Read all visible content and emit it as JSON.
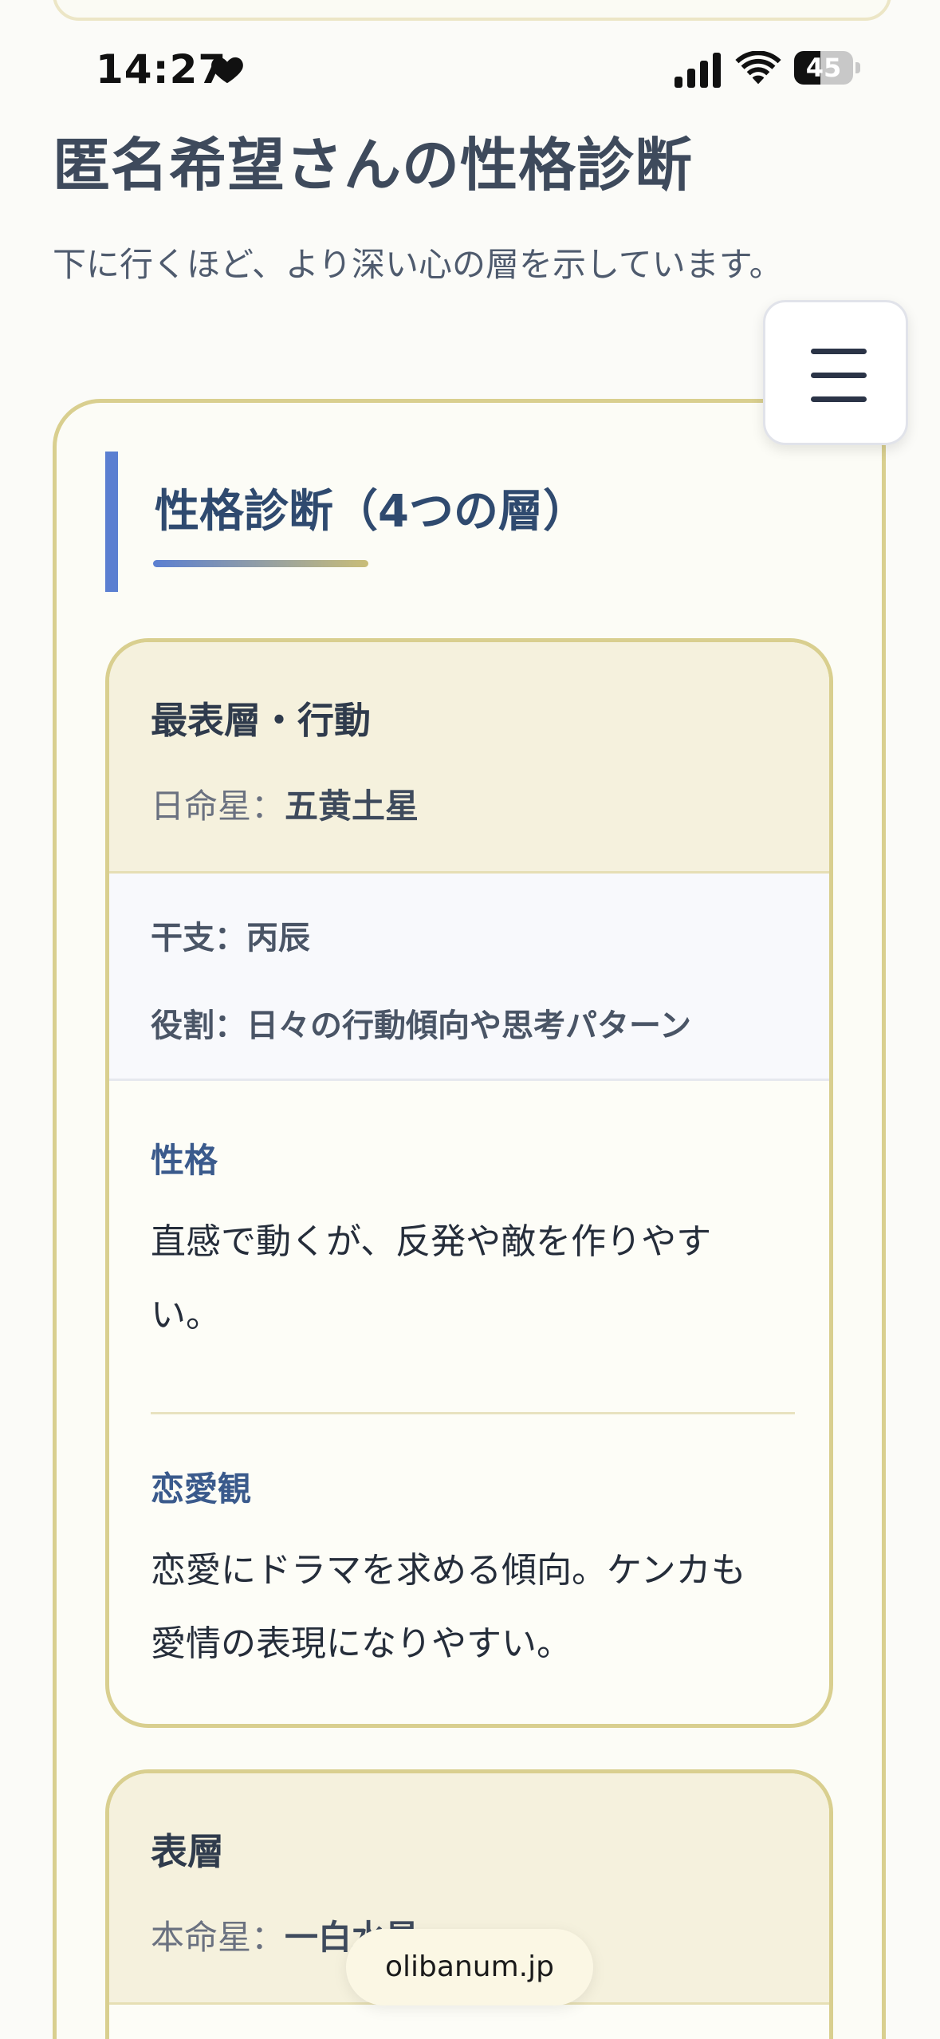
{
  "status_bar": {
    "time": "14:27",
    "battery_level": "45",
    "battery_fraction": 0.45
  },
  "header": {
    "title": "匿名希望さんの性格診断",
    "subtitle": "下に行くほど、より深い心の層を示しています。"
  },
  "menu": {
    "icon": "hamburger-menu-icon"
  },
  "section": {
    "title": "性格診断（4つの層）",
    "layers": [
      {
        "name": "最表層・行動",
        "star_label": "日命星：",
        "star_value": "五黄土星",
        "eto": "干支：丙辰",
        "role": "役割：日々の行動傾向や思考パターン",
        "personality_label": "性格",
        "personality_text": "直感で動くが、反発や敵を作りやすい。",
        "love_label": "恋愛観",
        "love_text": "恋愛にドラマを求める傾向。ケンカも愛情の表現になりやすい。"
      },
      {
        "name": "表層",
        "star_label": "本命星：",
        "star_value": "一白水星"
      }
    ]
  },
  "browser": {
    "url": "olibanum.jp"
  },
  "colors": {
    "accent_blue": "#5b7fd1",
    "card_border": "#d9cf8f",
    "card_head_bg": "#f5f1dd",
    "label_blue": "#3a5a8c"
  }
}
